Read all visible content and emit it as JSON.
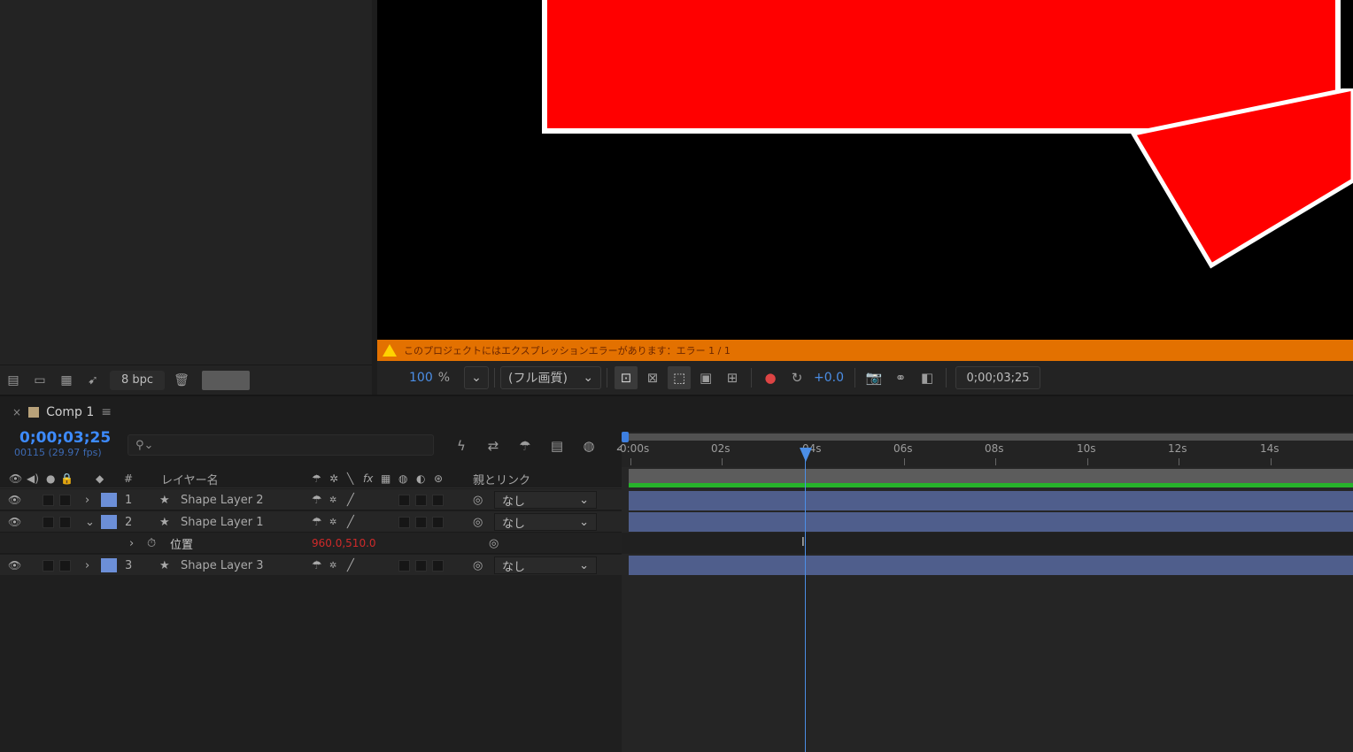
{
  "project": {
    "bpc_label": "8 bpc",
    "footer_icons": [
      "interpret-footage-icon",
      "new-folder-icon",
      "new-composition-icon",
      "render-queue-icon"
    ],
    "trash_icon": "trash-icon"
  },
  "viewer": {
    "warning_text": "このプロジェクトにはエクスプレッションエラーがあります：エラー 1 / 1",
    "zoom": "100",
    "zoom_unit": "%",
    "resolution": "(フル画質)",
    "exposure": "+0.0",
    "timecode": "0;00;03;25"
  },
  "timeline": {
    "comp_name": "Comp 1",
    "timecode": "0;00;03;25",
    "fps": "00115 (29.97 fps)",
    "search_placeholder": "",
    "columns": {
      "number": "#",
      "layer_name": "レイヤー名",
      "fx": "fx",
      "parent": "親とリンク"
    },
    "ruler_ticks": [
      "0:00s",
      "02s",
      "04s",
      "06s",
      "08s",
      "10s",
      "12s",
      "14s"
    ],
    "layers": [
      {
        "num": "1",
        "name": "Shape Layer 2",
        "parent": "なし",
        "expanded": false
      },
      {
        "num": "2",
        "name": "Shape Layer 1",
        "parent": "なし",
        "expanded": true
      },
      {
        "num": "3",
        "name": "Shape Layer 3",
        "parent": "なし",
        "expanded": false
      }
    ],
    "property": {
      "name": "位置",
      "value": "960.0,510.0",
      "value_color": "#d02a2a"
    }
  },
  "colors": {
    "accent_blue": "#3d8bff",
    "warning_orange": "#e37100",
    "layer_label": "#6c8fd8",
    "shape_red": "#ff0000",
    "bar_blue": "#4f5e8c",
    "work_area_green": "#26b32b"
  }
}
